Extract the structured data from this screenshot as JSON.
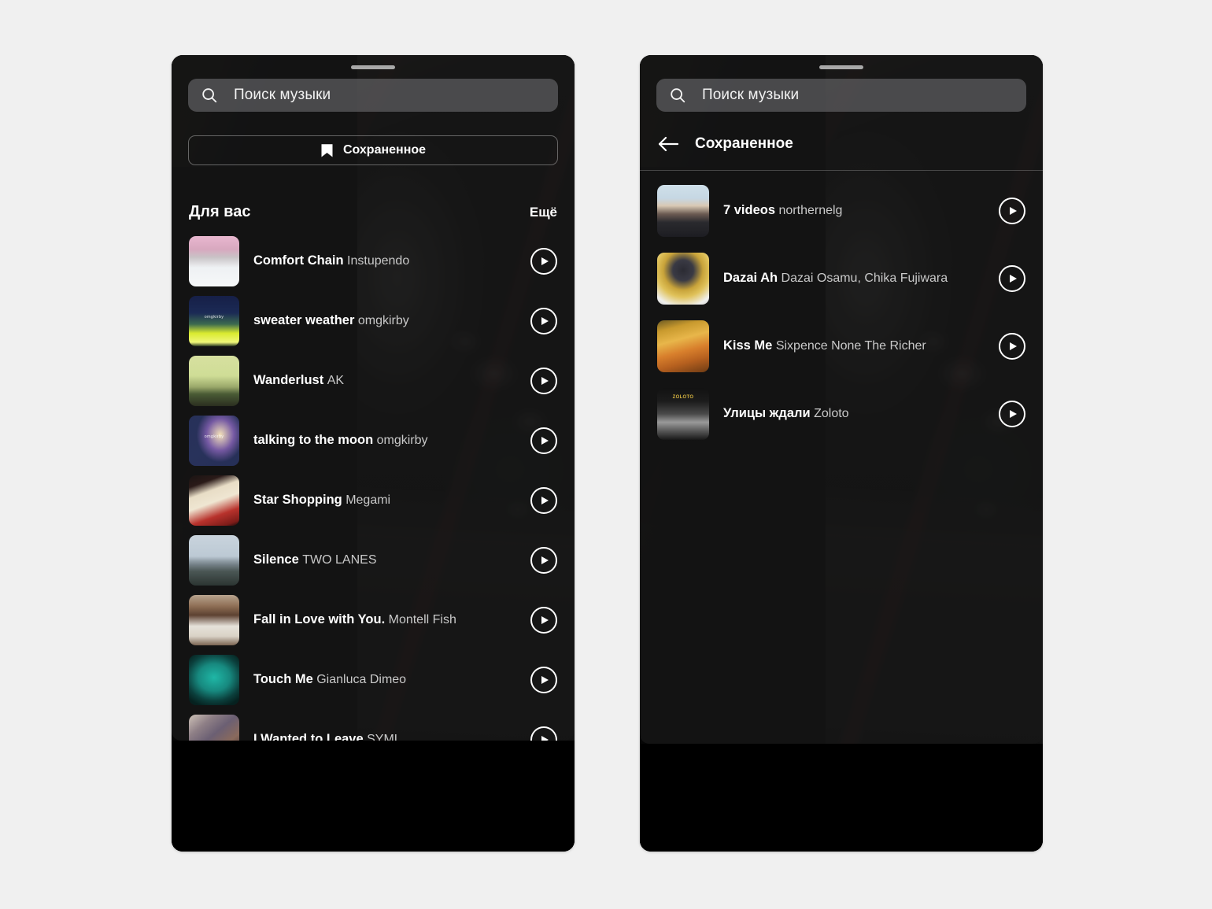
{
  "screens": {
    "left": {
      "name": "music-picker-for-you",
      "search": {
        "placeholder": "Поиск музыки",
        "icon": "search-icon"
      },
      "saved_button": {
        "label": "Сохраненное",
        "icon": "bookmark-icon"
      },
      "section": {
        "title": "Для вас",
        "more_label": "Ещё"
      },
      "tracks": [
        {
          "title": "Comfort Chain",
          "artist": "Instupendo",
          "art": "art-comfort-chain"
        },
        {
          "title": "sweater weather",
          "artist": "omgkirby",
          "art": "art-sweater-weather",
          "art_tag": "omgkirby"
        },
        {
          "title": "Wanderlust",
          "artist": "AK",
          "art": "art-wanderlust"
        },
        {
          "title": "talking to the moon",
          "artist": "omgkirby",
          "art": "art-talking-to-the-moon",
          "art_tag": "omgkirby"
        },
        {
          "title": "Star Shopping",
          "artist": "Megami",
          "art": "art-star-shopping"
        },
        {
          "title": "Silence",
          "artist": "TWO LANES",
          "art": "art-silence"
        },
        {
          "title": "Fall in Love with You.",
          "artist": "Montell Fish",
          "art": "art-fall-in-love"
        },
        {
          "title": "Touch Me",
          "artist": "Gianluca Dimeo",
          "art": "art-touch-me"
        },
        {
          "title": "I Wanted to Leave",
          "artist": "SYML",
          "art": "art-i-wanted-to-leave"
        }
      ]
    },
    "right": {
      "name": "music-picker-saved",
      "search": {
        "placeholder": "Поиск музыки",
        "icon": "search-icon"
      },
      "back": {
        "label": "Сохраненное",
        "icon": "arrow-left-icon"
      },
      "tracks": [
        {
          "title": "7 videos",
          "artist": "northernelg",
          "art": "art-northernelg"
        },
        {
          "title": "Dazai Ah",
          "artist": "Dazai Osamu, Chika Fujiwara",
          "art": "art-dazai-ah"
        },
        {
          "title": "Kiss Me",
          "artist": "Sixpence None The Richer",
          "art": "art-kiss-me"
        },
        {
          "title": "Улицы ждали",
          "artist": "Zoloto",
          "art": "art-ulitsy-zhdali",
          "art_tag": "ZOLOTO"
        }
      ]
    }
  },
  "colors": {
    "page_background": "#f0f0f0",
    "sheet": "#181818",
    "search_field": "#76767a",
    "text_primary": "#ffffff",
    "text_secondary": "#c9c9c9",
    "accent_outline": "#ffffff"
  }
}
